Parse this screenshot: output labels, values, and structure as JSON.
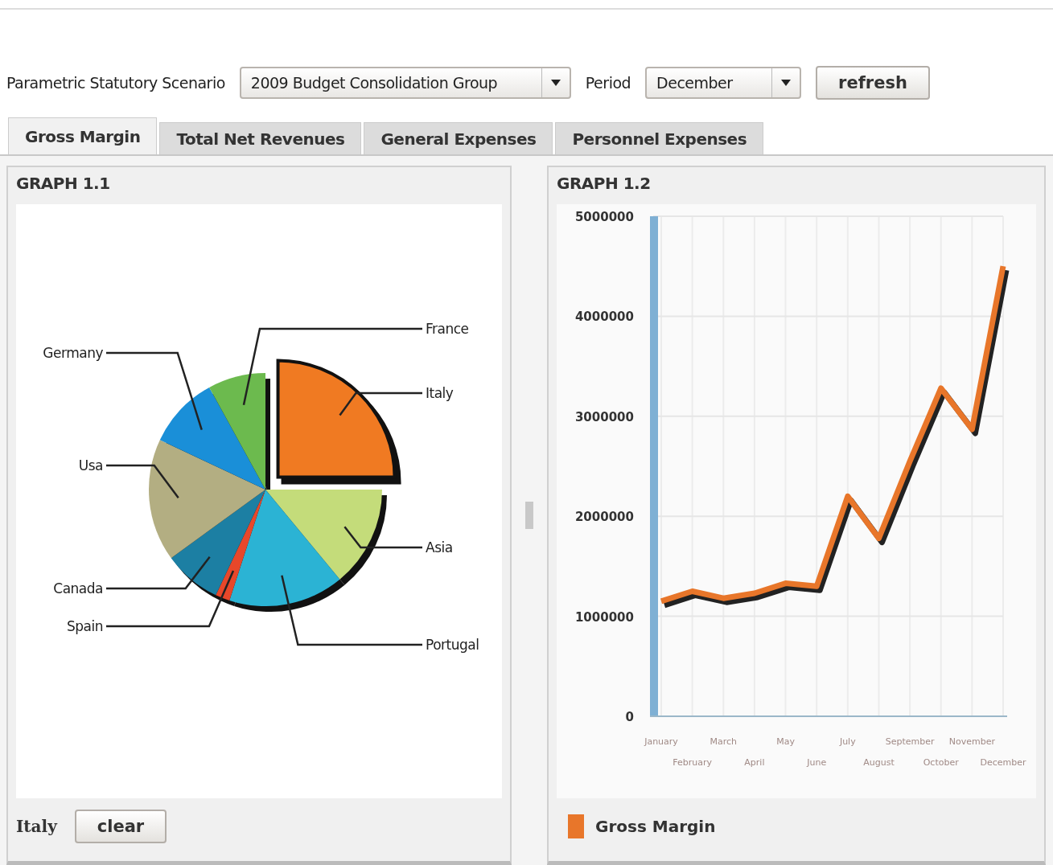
{
  "toolbar": {
    "scenario_label": "Parametric Statutory Scenario",
    "scenario_value": "2009 Budget Consolidation Group",
    "period_label": "Period",
    "period_value": "December",
    "refresh_button": "refresh"
  },
  "tabs": [
    {
      "label": "Gross Margin",
      "selected": true
    },
    {
      "label": "Total Net Revenues",
      "selected": false
    },
    {
      "label": "General Expenses",
      "selected": false
    },
    {
      "label": "Personnel Expenses",
      "selected": false
    }
  ],
  "graph1": {
    "title": "GRAPH 1.1",
    "chart_data": {
      "type": "pie",
      "categories": [
        "Italy",
        "Asia",
        "Portugal",
        "Spain",
        "Canada",
        "Usa",
        "Germany",
        "France"
      ],
      "values": [
        0.25,
        0.14,
        0.16,
        0.02,
        0.08,
        0.17,
        0.1,
        0.08
      ]
    },
    "slices": [
      {
        "color": "#f07a22",
        "selected": true
      },
      {
        "color": "#c4dc7a",
        "selected": false
      },
      {
        "color": "#2bb3d4",
        "selected": false
      },
      {
        "color": "#e8472a",
        "selected": false
      },
      {
        "color": "#1c7fa3",
        "selected": false
      },
      {
        "color": "#b3ae82",
        "selected": false
      },
      {
        "color": "#1a8fd8",
        "selected": false
      },
      {
        "color": "#6cba4e",
        "selected": false
      }
    ],
    "selection_label": "Italy",
    "clear_button": "clear"
  },
  "graph2": {
    "title": "GRAPH 1.2",
    "chart_data": {
      "type": "line",
      "categories": [
        "January",
        "February",
        "March",
        "April",
        "May",
        "June",
        "July",
        "August",
        "September",
        "October",
        "November",
        "December"
      ],
      "series": [
        {
          "name": "Gross Margin",
          "color": "#e8762a",
          "values": [
            1150000,
            1250000,
            1180000,
            1230000,
            1330000,
            1300000,
            2200000,
            1780000,
            2550000,
            3280000,
            2870000,
            4500000
          ]
        }
      ],
      "grid": true,
      "ylim": [
        0,
        5000000
      ],
      "yticks": [
        0,
        1000000,
        2000000,
        3000000,
        4000000,
        5000000
      ]
    }
  }
}
